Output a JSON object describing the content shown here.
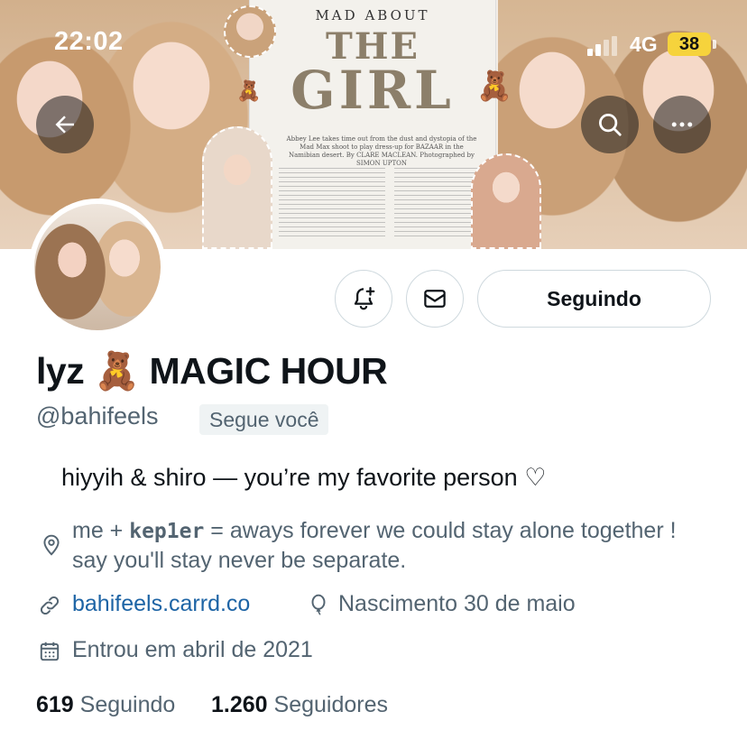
{
  "status_bar": {
    "time": "22:02",
    "network": "4G",
    "battery": "38",
    "battery_color": "#f6d33c"
  },
  "banner": {
    "magazine_kicker": "MAD ABOUT",
    "magazine_title_line1": "THE",
    "magazine_title_line2": "GIRL",
    "magazine_deck": "Abbey Lee takes time out from the dust and dystopia of the Mad Max shoot to play dress-up for BAZAAR in the Namibian desert. By CLARE MACLEAN. Photographed by SIMON UPTON"
  },
  "header_buttons": {
    "back_icon": "arrow-left-icon",
    "search_icon": "search-icon",
    "more_icon": "more-horizontal-icon"
  },
  "actions": {
    "notify_icon": "bell-plus-icon",
    "message_icon": "envelope-icon",
    "follow_label": "Seguindo"
  },
  "profile": {
    "display_name": "lyz 🧸 MAGIC HOUR",
    "username": "@bahifeels",
    "follows_you_badge": "Segue você",
    "bio": "hiyyih & shiro — you’re my favorite person ♡",
    "location_prefix": "me  +  ",
    "location_bold": "kep1er",
    "location_suffix": "  =  aways forever we could stay alone together ! say you'll stay never be separate.",
    "website": "bahifeels.carrd.co",
    "birthday": "Nascimento 30 de maio",
    "joined": "Entrou em abril de 2021"
  },
  "stats": {
    "following_count": "619",
    "following_label": "Seguindo",
    "followers_count": "1.260",
    "followers_label": "Seguidores"
  },
  "colors": {
    "link": "#1d64a5",
    "secondary_text": "#536471",
    "primary_text": "#0f1419",
    "border": "#cfd9de"
  }
}
